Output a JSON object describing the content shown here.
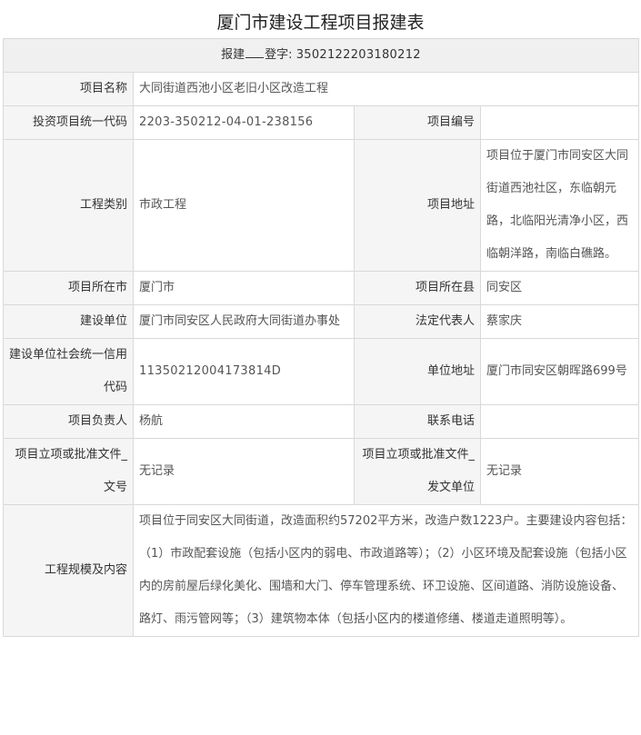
{
  "title": "厦门市建设工程项目报建表",
  "registration": {
    "prefix": "报建",
    "suffix": "登字:",
    "number": "3502122203180212"
  },
  "rows": {
    "project_name": {
      "label": "项目名称",
      "value": "大同街道西池小区老旧小区改造工程"
    },
    "invest_code": {
      "label": "投资项目统一代码",
      "value": "2203-350212-04-01-238156"
    },
    "project_no": {
      "label": "项目编号",
      "value": ""
    },
    "eng_type": {
      "label": "工程类别",
      "value": "市政工程"
    },
    "address": {
      "label": "项目地址",
      "value": "项目位于厦门市同安区大同街道西池社区，东临朝元路，北临阳光清净小区，西临朝洋路，南临白礁路。"
    },
    "city": {
      "label": "项目所在市",
      "value": "厦门市"
    },
    "county": {
      "label": "项目所在县",
      "value": "同安区"
    },
    "builder": {
      "label": "建设单位",
      "value": "厦门市同安区人民政府大同街道办事处"
    },
    "legal_rep": {
      "label": "法定代表人",
      "value": "蔡家庆"
    },
    "credit_code": {
      "label": "建设单位社会统一信用代码",
      "value": "11350212004173814D"
    },
    "unit_addr": {
      "label": "单位地址",
      "value": "厦门市同安区朝晖路699号"
    },
    "leader": {
      "label": "项目负责人",
      "value": "杨航"
    },
    "phone": {
      "label": "联系电话",
      "value": ""
    },
    "doc_no": {
      "label": "项目立项或批准文件_文号",
      "value": "无记录"
    },
    "doc_unit": {
      "label": "项目立项或批准文件_发文单位",
      "value": "无记录"
    },
    "scale": {
      "label": "工程规模及内容",
      "value": "项目位于同安区大同街道，改造面积约57202平方米，改造户数1223户。主要建设内容包括：（1）市政配套设施（包括小区内的弱电、市政道路等）；（2）小区环境及配套设施（包括小区内的房前屋后绿化美化、围墙和大门、停车管理系统、环卫设施、区间道路、消防设施设备、路灯、雨污管网等；（3）建筑物本体（包括小区内的楼道修缮、楼道走道照明等）。"
    }
  }
}
